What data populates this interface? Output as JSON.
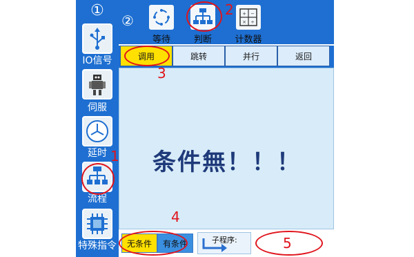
{
  "sidebar": {
    "header_number": "①",
    "items": [
      {
        "label": "IO信号",
        "icon": "usb-icon"
      },
      {
        "label": "伺服",
        "icon": "robot-icon"
      },
      {
        "label": "延时",
        "icon": "clock-icon"
      },
      {
        "label": "流程",
        "icon": "flowchart-icon"
      },
      {
        "label": "特殊指令",
        "icon": "chip-icon"
      }
    ]
  },
  "toolbar": {
    "header_number": "②",
    "items": [
      {
        "label": "等待",
        "icon": "refresh-icon"
      },
      {
        "label": "判断",
        "icon": "flowchart-icon"
      },
      {
        "label": "计数器",
        "icon": "calculator-icon"
      }
    ]
  },
  "tabs": [
    {
      "label": "调用"
    },
    {
      "label": "跳转"
    },
    {
      "label": "并行"
    },
    {
      "label": "返回"
    }
  ],
  "main": {
    "message": "条件無！！！"
  },
  "bottom": {
    "no_condition": "无条件",
    "with_condition": "有条件",
    "subprogram_label": "子程序:"
  },
  "annotations": {
    "n1": "1",
    "n2": "2",
    "n3": "3",
    "n4": "4",
    "n5": "5"
  },
  "colors": {
    "frame_blue": "#1e6fd1",
    "panel_bg": "#d7ecf8",
    "active_yellow": "#ffe000",
    "annotation_red": "#e0141c",
    "message_color": "#1f3a7a"
  }
}
